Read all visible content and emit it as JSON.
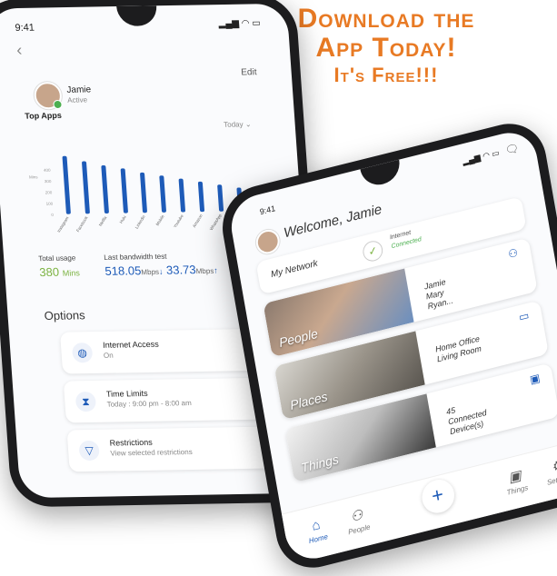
{
  "headline": {
    "line1": "Download the",
    "line2": "App Today!",
    "line3": "It's Free!!!"
  },
  "colors": {
    "accent": "#e87a24",
    "brand_blue": "#1e5bb8",
    "green": "#7cb342"
  },
  "phone1": {
    "time": "9:41",
    "status_icons": "▂▄▆ ◠ ▭",
    "back_icon": "chevron-left",
    "edit_label": "Edit",
    "user_name": "Jamie",
    "user_status": "Active",
    "section_title": "Top Apps",
    "period": "Today",
    "chart_data": {
      "type": "bar",
      "categories": [
        "Instagram",
        "Facebook",
        "Netflix",
        "Hulu",
        "Linkedin",
        "Mobile",
        "Youtube",
        "Amazon",
        "WhatsApp",
        "YouTube"
      ],
      "values": [
        520,
        470,
        430,
        400,
        360,
        330,
        300,
        270,
        240,
        210
      ],
      "yticks": [
        "400",
        "300",
        "200",
        "100",
        "0"
      ],
      "ylabel": "Mins",
      "ylim": [
        0,
        600
      ],
      "series_color": "#1e5bb8"
    },
    "total_usage_label": "Total usage",
    "total_usage_value": "380",
    "total_usage_unit": "Mins",
    "bandwidth_label": "Last bandwidth test",
    "down_value": "518.05",
    "down_unit": "Mbps",
    "up_value": "33.73",
    "up_unit": "Mbps",
    "options_title": "Options",
    "options": [
      {
        "title": "Internet Access",
        "subtitle": "On",
        "icon": "globe-icon"
      },
      {
        "title": "Time Limits",
        "subtitle": "Today : 9:00 pm - 8:00 am",
        "icon": "hourglass-icon"
      },
      {
        "title": "Restrictions",
        "subtitle": "View selected restrictions",
        "icon": "filter-icon"
      }
    ]
  },
  "phone2": {
    "time": "9:41",
    "status_icons": "▂▄▆ ◠ ▭",
    "welcome": "Welcome, Jamie",
    "network_label": "My Network",
    "internet_label": "Internet",
    "internet_status": "Connected",
    "tiles": [
      {
        "caption": "People",
        "lines": [
          "Jamie",
          "Mary",
          "Ryan..."
        ],
        "icon": "people-icon"
      },
      {
        "caption": "Places",
        "lines": [
          "Home Office",
          "Living Room"
        ],
        "icon": "couch-icon"
      },
      {
        "caption": "Things",
        "lines": [
          "45",
          "Connected",
          "Device(s)"
        ],
        "icon": "devices-icon"
      }
    ],
    "nav": [
      {
        "label": "Home",
        "icon": "home-icon"
      },
      {
        "label": "People",
        "icon": "people-icon"
      },
      {
        "label": "Things",
        "icon": "devices-icon"
      },
      {
        "label": "Settings",
        "icon": "gear-icon"
      }
    ]
  }
}
